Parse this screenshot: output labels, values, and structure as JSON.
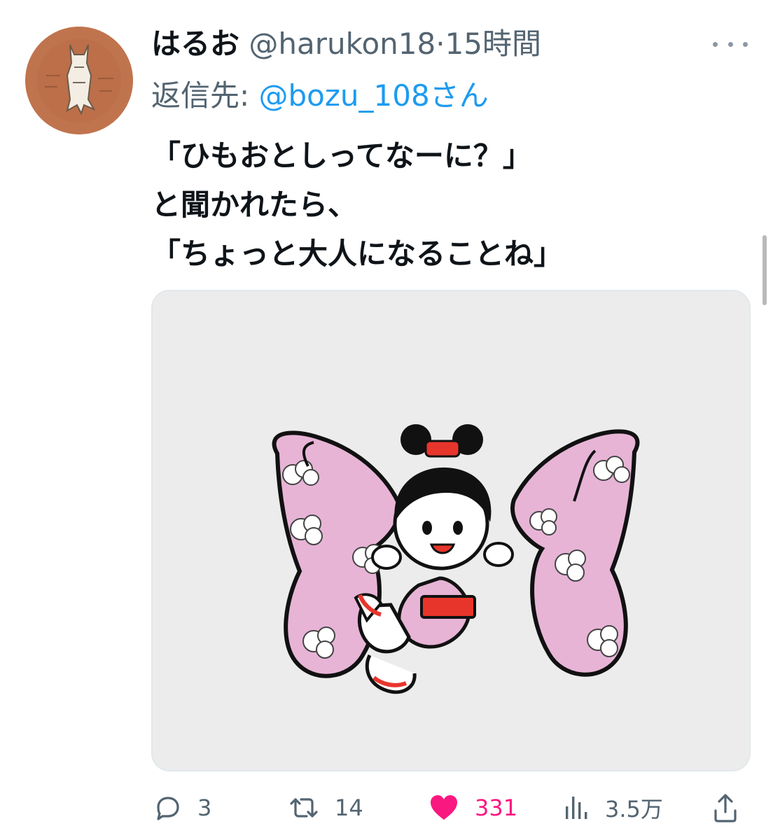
{
  "tweet": {
    "author_name": "はるお",
    "author_handle": "@harukon18",
    "separator": "·",
    "time": "15時間",
    "reply_label": "返信先:",
    "reply_to": "@bozu_108さん",
    "text_lines": [
      "「ひもおとしってなーに？」",
      "と聞かれたら、",
      "「ちょっと大人になることね」"
    ]
  },
  "actions": {
    "reply_count": "3",
    "retweet_count": "14",
    "like_count": "331",
    "views_count": "3.5万"
  },
  "icons": {
    "reply": "reply-icon",
    "retweet": "retweet-icon",
    "like": "heart-icon",
    "views": "views-icon",
    "share": "share-icon",
    "more": "more-icon"
  },
  "colors": {
    "text": "#0f1419",
    "secondary": "#536471",
    "link": "#1d9bf0",
    "like": "#f91880",
    "media_bg": "#ececec",
    "avatar_bg": "#c0744d"
  }
}
